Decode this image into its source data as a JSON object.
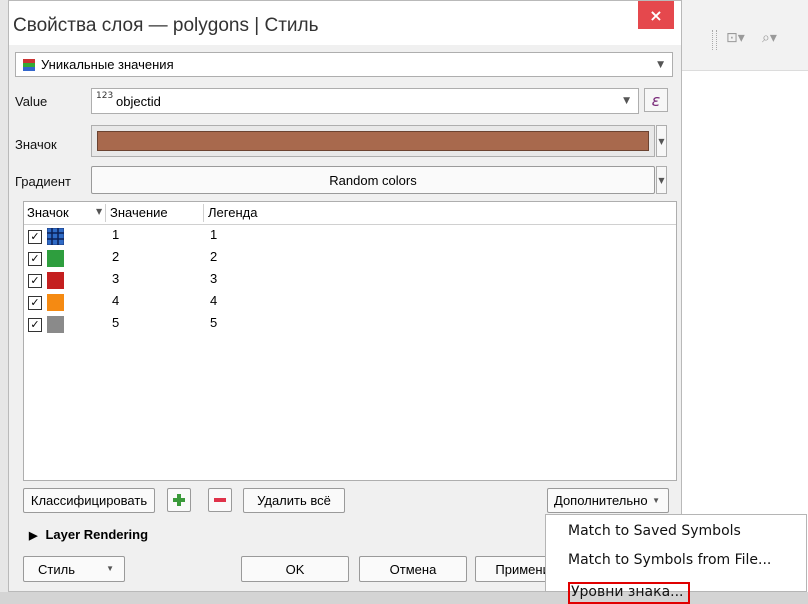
{
  "dialog": {
    "title": "Свойства слоя — polygons | Стиль",
    "close_label": "×"
  },
  "renderer": {
    "value": "Уникальные значения"
  },
  "value_row": {
    "label": "Value",
    "field_type": "123",
    "field": "objectid",
    "expr_label": "ε"
  },
  "symbol_row": {
    "label": "Значок",
    "color": "#a8694d"
  },
  "gradient_row": {
    "label": "Градиент",
    "value": "Random colors"
  },
  "table": {
    "headers": [
      "Значок",
      "Значение",
      "Легенда"
    ],
    "rows": [
      {
        "checked": "✓",
        "symbol": "hatch-blue",
        "color": "#2f6bc6",
        "value": "1",
        "legend": "1"
      },
      {
        "checked": "✓",
        "symbol": "solid",
        "color": "#2e9e3e",
        "value": "2",
        "legend": "2"
      },
      {
        "checked": "✓",
        "symbol": "solid",
        "color": "#c41f1f",
        "value": "3",
        "legend": "3"
      },
      {
        "checked": "✓",
        "symbol": "solid",
        "color": "#f58a12",
        "value": "4",
        "legend": "4"
      },
      {
        "checked": "✓",
        "symbol": "solid",
        "color": "#8a8a8a",
        "value": "5",
        "legend": "5"
      }
    ]
  },
  "buttons": {
    "classify": "Классифицировать",
    "delete_all": "Удалить всё",
    "advanced": "Дополнительно",
    "ok": "OK",
    "cancel": "Отмена",
    "apply": "Применить",
    "style": "Стиль"
  },
  "layer_rendering": "Layer Rendering",
  "menu": {
    "items": [
      "Match to Saved Symbols",
      "Match to Symbols from File...",
      "Уровни знака..."
    ]
  }
}
